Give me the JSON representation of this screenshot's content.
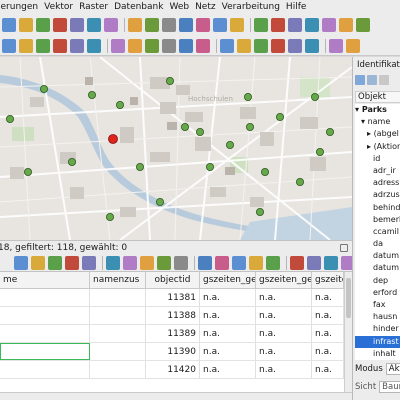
{
  "menubar": [
    "ierungen",
    "Vektor",
    "Raster",
    "Datenbank",
    "Web",
    "Netz",
    "Verarbeitung",
    "Hilfe"
  ],
  "toolbar1_icons": [
    "open-project",
    "save-project",
    "zoom-in",
    "zoom-out",
    "pan",
    "zoom-full",
    "zoom-layer",
    "zoom-selection",
    "zoom-last",
    "zoom-next",
    "refresh",
    "new-bookmark",
    "show-bookmarks",
    "identify",
    "select",
    "attribute-table",
    "field-calculator",
    "sigma",
    "measure",
    "map-tips",
    "annotation"
  ],
  "toolbar2_icons": [
    "edit-toggle",
    "save-edits",
    "digitize",
    "move-feature",
    "node-tool",
    "delete",
    "cut",
    "copy",
    "paste",
    "undo",
    "redo",
    "label-abc",
    "label-pin",
    "label-move",
    "label-rotate",
    "label-change",
    "label-show",
    "label-abc2",
    "python",
    "plugin"
  ],
  "attribute_table": {
    "status": "18, gefiltert: 118, gewählt: 0",
    "columns": [
      "me",
      "namenzus",
      "objectid",
      "gszeiten_geba",
      "gszeiten_geba",
      "gszeite"
    ],
    "rows": [
      [
        "",
        "",
        "11381",
        "n.a.",
        "n.a.",
        "n.a."
      ],
      [
        "",
        "",
        "11388",
        "n.a.",
        "n.a.",
        "n.a."
      ],
      [
        "",
        "",
        "11389",
        "n.a.",
        "n.a.",
        "n.a."
      ],
      [
        "",
        "",
        "11390",
        "n.a.",
        "n.a.",
        "n.a."
      ],
      [
        "",
        "",
        "11420",
        "n.a.",
        "n.a.",
        "n.a."
      ]
    ]
  },
  "identify_panel": {
    "title": "Identifikatio",
    "object_header": "Objekt",
    "tree": [
      {
        "label": "Parks",
        "indent": 0,
        "bold": true,
        "arrow": "▾"
      },
      {
        "label": "name",
        "indent": 1,
        "arrow": "▾"
      },
      {
        "label": "(abgel",
        "indent": 2,
        "arrow": "▸"
      },
      {
        "label": "(Aktion",
        "indent": 2,
        "arrow": "▸"
      },
      {
        "label": "id",
        "indent": 2
      },
      {
        "label": "adr_ir",
        "indent": 2
      },
      {
        "label": "adress",
        "indent": 2
      },
      {
        "label": "adrzus",
        "indent": 2
      },
      {
        "label": "behind",
        "indent": 2
      },
      {
        "label": "bemerk",
        "indent": 2
      },
      {
        "label": "ccamil",
        "indent": 2
      },
      {
        "label": "da",
        "indent": 2
      },
      {
        "label": "datum",
        "indent": 2
      },
      {
        "label": "datum",
        "indent": 2
      },
      {
        "label": "dep",
        "indent": 2
      },
      {
        "label": "erford",
        "indent": 2
      },
      {
        "label": "fax",
        "indent": 2
      },
      {
        "label": "hausn",
        "indent": 2
      },
      {
        "label": "hinder",
        "indent": 2
      },
      {
        "label": "infrast",
        "indent": 2,
        "selected": true
      },
      {
        "label": "inhalt",
        "indent": 2
      }
    ],
    "mode_label": "Modus",
    "mode_value": "Akt",
    "view_label": "Sicht",
    "view_value": "Baum"
  },
  "map": {
    "park_color": "#66a84a",
    "selected_color": "#e0241c",
    "labels": [
      "Hochschulen"
    ]
  },
  "colors": {
    "selection": "#2a6fd6",
    "toolbar_bg": "#ececec"
  }
}
